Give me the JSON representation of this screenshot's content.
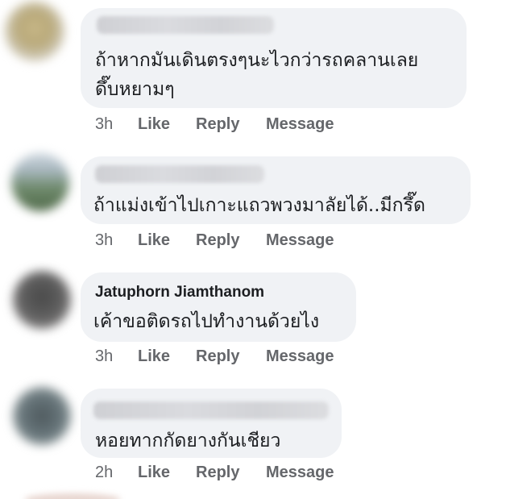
{
  "comments": [
    {
      "author": "",
      "author_visible": false,
      "text_lines": [
        "ถ้าหากมันเดินตรงๆนะไวกว่ารถคลานเลย",
        "ดึ๊บหยามๆ"
      ],
      "time": "3h",
      "actions": {
        "like": "Like",
        "reply": "Reply",
        "message": "Message"
      }
    },
    {
      "author": "",
      "author_visible": false,
      "text_lines": [
        "ถ้าแม่งเข้าไปเกาะแถวพวงมาลัยได้..มีกรึ๊ด"
      ],
      "time": "3h",
      "actions": {
        "like": "Like",
        "reply": "Reply",
        "message": "Message"
      }
    },
    {
      "author": "Jatuphorn Jiamthanom",
      "author_visible": true,
      "text_lines": [
        "เค้าขอติดรถไปทำงานด้วยไง"
      ],
      "time": "3h",
      "actions": {
        "like": "Like",
        "reply": "Reply",
        "message": "Message"
      }
    },
    {
      "author": "",
      "author_visible": false,
      "text_lines": [
        "หอยทากกัดยางกันเชียว"
      ],
      "time": "2h",
      "actions": {
        "like": "Like",
        "reply": "Reply",
        "message": "Message"
      }
    }
  ],
  "colors": {
    "bubble": "#f0f2f5",
    "text": "#1c1e21",
    "meta": "#65676b"
  }
}
